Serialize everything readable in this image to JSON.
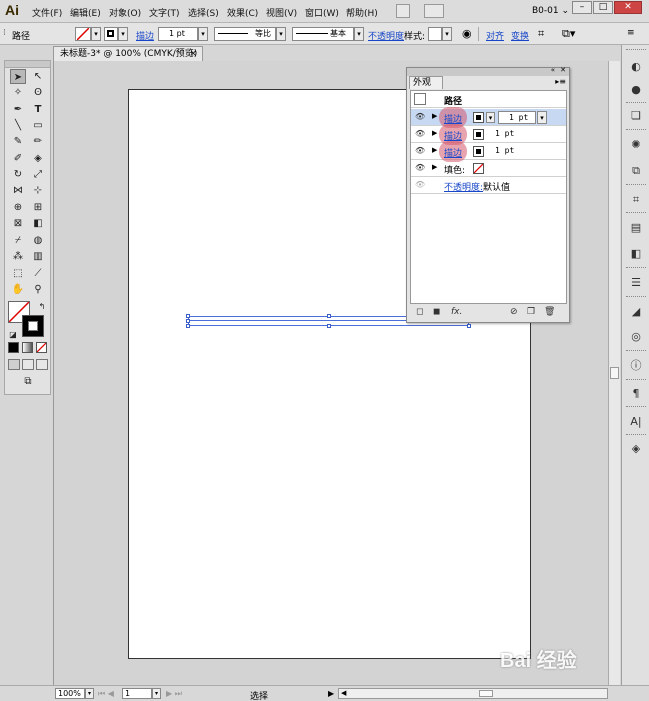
{
  "app": {
    "logo": "Ai",
    "menus": [
      "文件(F)",
      "编辑(E)",
      "对象(O)",
      "文字(T)",
      "选择(S)",
      "效果(C)",
      "视图(V)",
      "窗口(W)",
      "帮助(H)"
    ],
    "workspace": "B0-01 ⌄",
    "window_controls": [
      "–",
      "□",
      "✕"
    ]
  },
  "control_bar": {
    "object_type": "路径",
    "stroke_label": "描边",
    "stroke_weight": "1 pt",
    "profile_label": "等比",
    "brush_label": "基本",
    "opacity_label": "不透明度",
    "style_label": "样式:",
    "align_label": "对齐",
    "transform_label": "变换"
  },
  "document": {
    "tab_title": "未标题-3* @ 100% (CMYK/预览)",
    "close": "×"
  },
  "appearance_panel": {
    "tab": "外观",
    "header": "路径",
    "rows": [
      {
        "label": "描边",
        "value": "1 pt",
        "selected": true
      },
      {
        "label": "描边",
        "value": "1 pt",
        "selected": false
      },
      {
        "label": "描边",
        "value": "1 pt",
        "selected": false
      }
    ],
    "fill_label": "填色:",
    "opacity_label": "不透明度:",
    "opacity_value": "默认值",
    "fx_label": "fx."
  },
  "status_bar": {
    "zoom": "100%",
    "page": "1",
    "tool": "选择"
  },
  "watermark": "Bai 经验"
}
